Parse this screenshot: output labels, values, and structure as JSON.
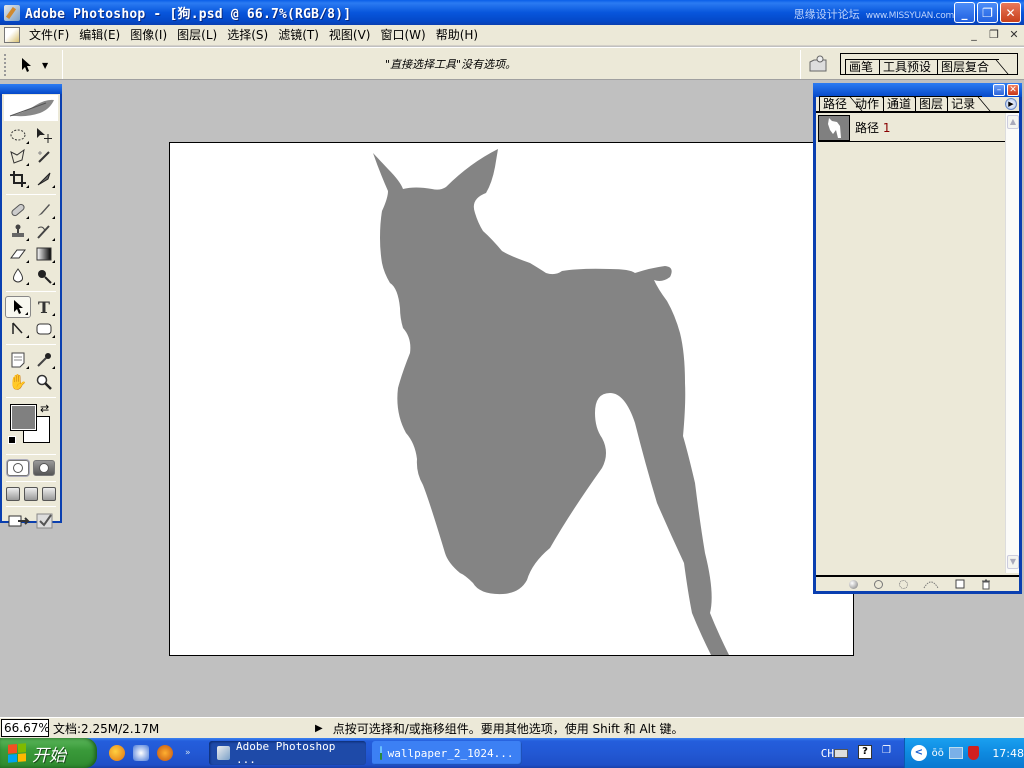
{
  "window": {
    "title": "Adobe Photoshop - [狗.psd @ 66.7%(RGB/8)]",
    "watermark": "思缘设计论坛",
    "watermark_url": "www.MISSYUAN.com"
  },
  "menu": {
    "items": [
      "文件(F)",
      "编辑(E)",
      "图像(I)",
      "图层(L)",
      "选择(S)",
      "滤镜(T)",
      "视图(V)",
      "窗口(W)",
      "帮助(H)"
    ]
  },
  "options_bar": {
    "message": "\"直接选择工具\"没有选项。",
    "palette_well_tabs": [
      "画笔",
      "工具预设",
      "图层复合"
    ]
  },
  "toolbox": {
    "active_tool": "direct-selection",
    "foreground_color": "#808080",
    "background_color": "#ffffff"
  },
  "canvas": {
    "fill_color": "#848484",
    "background": "#ffffff",
    "content": "horse silhouette"
  },
  "paths_panel": {
    "tabs": [
      "路径",
      "动作",
      "通道",
      "图层",
      "记录"
    ],
    "active_tab": "路径",
    "paths": [
      {
        "name": "路径",
        "number": "1"
      }
    ]
  },
  "status_bar": {
    "zoom": "66.67%",
    "doc_size": "文档:2.25M/2.17M",
    "hint": "点按可选择和/或拖移组件。要用其他选项，使用 Shift 和 Alt 键。"
  },
  "taskbar": {
    "start_label": "开始",
    "tasks": [
      {
        "label": "Adobe Photoshop ...",
        "active": true
      },
      {
        "label": "wallpaper_2_1024...",
        "active": false
      }
    ],
    "language": "CH",
    "clock": "17:48"
  }
}
